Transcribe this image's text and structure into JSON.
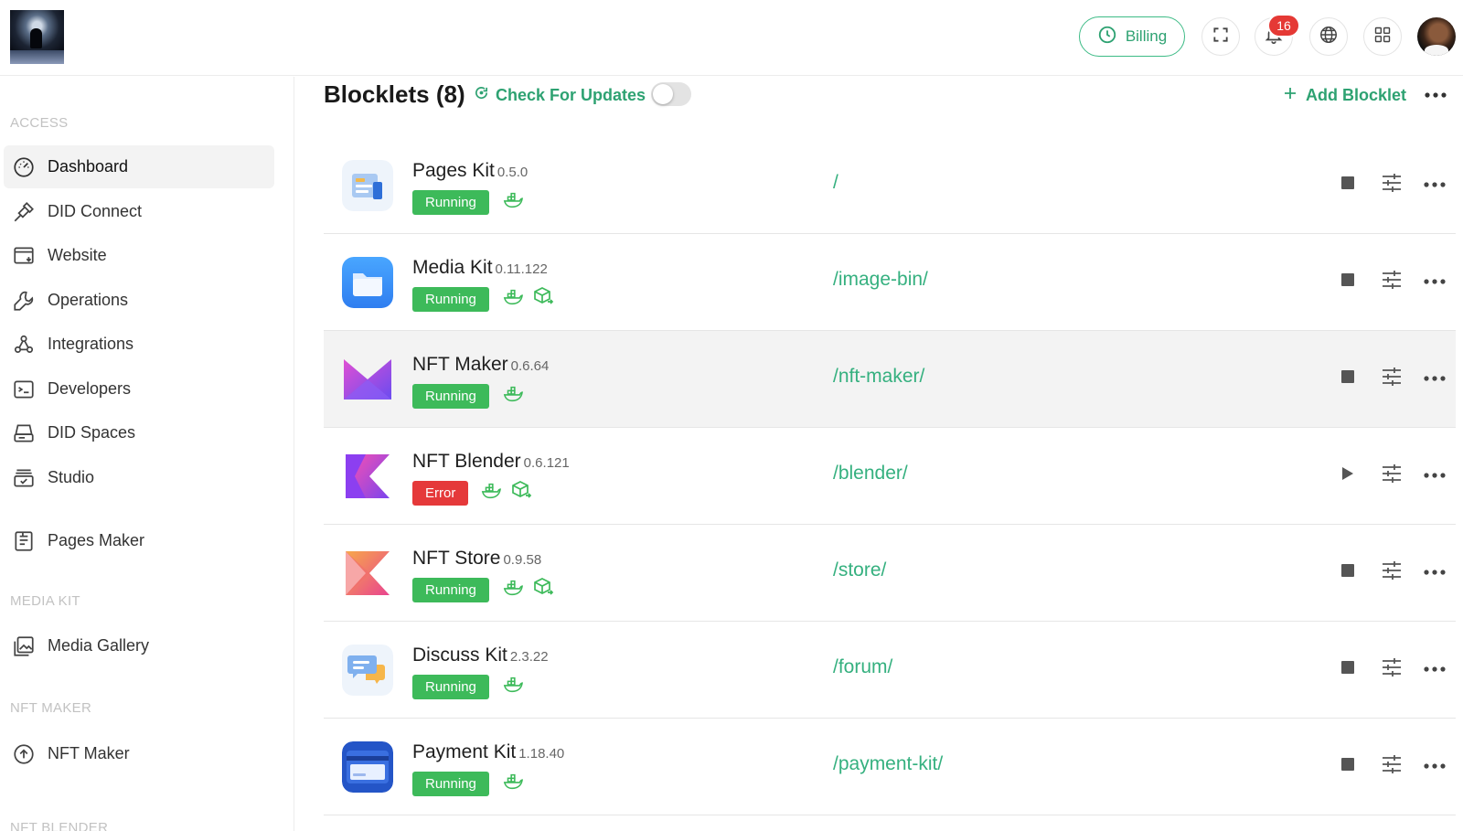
{
  "header": {
    "billing_label": "Billing",
    "notification_count": "16",
    "icons": [
      "clock-icon",
      "fullscreen-icon",
      "bell-icon",
      "globe-icon",
      "apps-grid-icon"
    ]
  },
  "sidebar": {
    "sections": [
      {
        "label": "ACCESS"
      },
      {
        "label": "MEDIA KIT"
      },
      {
        "label": "NFT MAKER"
      },
      {
        "label": "NFT BLENDER"
      }
    ],
    "items": [
      {
        "label": "Dashboard",
        "icon": "dashboard-gauge-icon",
        "active": true
      },
      {
        "label": "DID Connect",
        "icon": "plug-icon"
      },
      {
        "label": "Website",
        "icon": "website-icon"
      },
      {
        "label": "Operations",
        "icon": "wrench-icon"
      },
      {
        "label": "Integrations",
        "icon": "webhook-icon"
      },
      {
        "label": "Developers",
        "icon": "terminal-icon"
      },
      {
        "label": "DID Spaces",
        "icon": "storage-icon"
      },
      {
        "label": "Studio",
        "icon": "studio-icon"
      },
      {
        "label": "Pages Maker",
        "icon": "pages-icon"
      },
      {
        "label": "Media Gallery",
        "icon": "gallery-icon"
      },
      {
        "label": "NFT Maker",
        "icon": "upload-circle-icon"
      }
    ]
  },
  "main": {
    "title": "Blocklets (8)",
    "check_updates_label": "Check For Updates",
    "auto_update_enabled": false,
    "add_blocklet_label": "Add Blocklet"
  },
  "blocklets": [
    {
      "name": "Pages Kit",
      "version": "0.5.0",
      "status": "Running",
      "path": "/",
      "has_docker": true,
      "has_component": false,
      "action": "stop"
    },
    {
      "name": "Media Kit",
      "version": "0.11.122",
      "status": "Running",
      "path": "/image-bin/",
      "has_docker": true,
      "has_component": true,
      "action": "stop"
    },
    {
      "name": "NFT Maker",
      "version": "0.6.64",
      "status": "Running",
      "path": "/nft-maker/",
      "has_docker": true,
      "has_component": false,
      "action": "stop"
    },
    {
      "name": "NFT Blender",
      "version": "0.6.121",
      "status": "Error",
      "path": "/blender/",
      "has_docker": true,
      "has_component": true,
      "action": "start"
    },
    {
      "name": "NFT Store",
      "version": "0.9.58",
      "status": "Running",
      "path": "/store/",
      "has_docker": true,
      "has_component": true,
      "action": "stop"
    },
    {
      "name": "Discuss Kit",
      "version": "2.3.22",
      "status": "Running",
      "path": "/forum/",
      "has_docker": true,
      "has_component": false,
      "action": "stop"
    },
    {
      "name": "Payment Kit",
      "version": "1.18.40",
      "status": "Running",
      "path": "/payment-kit/",
      "has_docker": true,
      "has_component": false,
      "action": "stop"
    }
  ],
  "colors": {
    "accent": "#2ea272",
    "running": "#3dba5a",
    "error": "#e5393a",
    "badge": "#e53935"
  }
}
